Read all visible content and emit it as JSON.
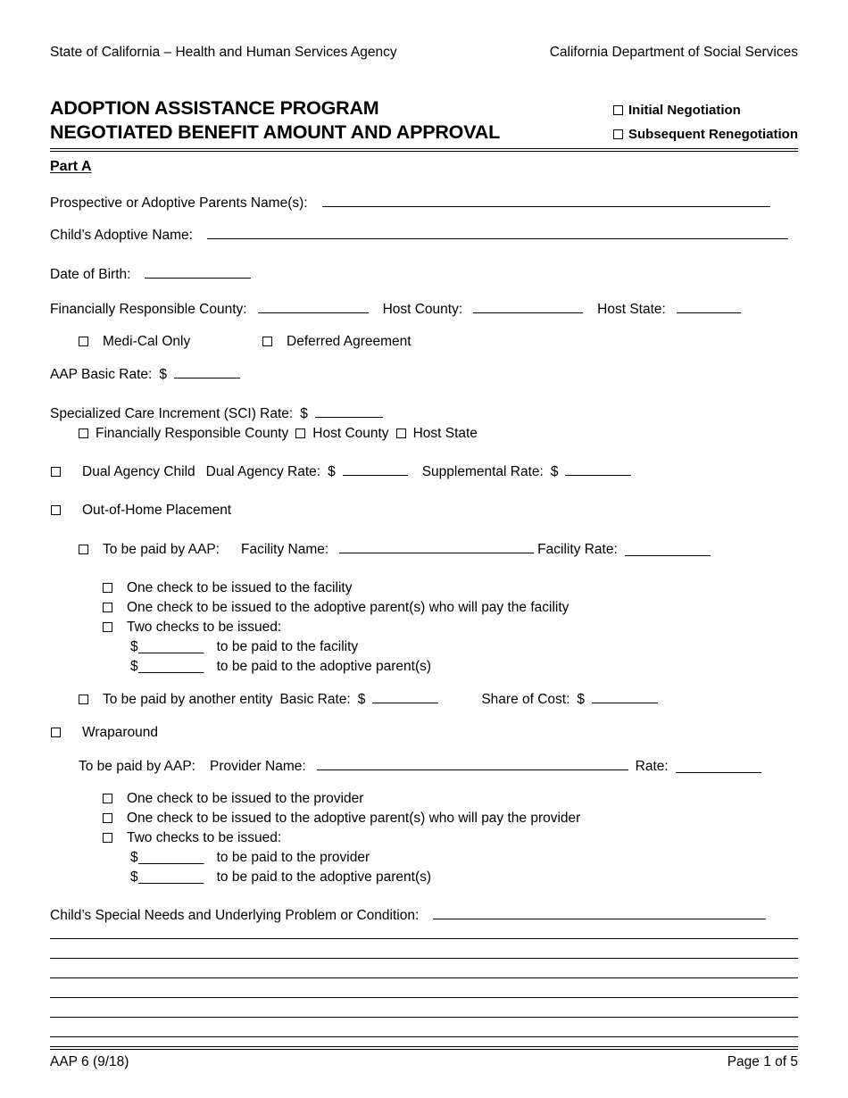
{
  "header": {
    "left": "State of California – Health and Human Services Agency",
    "right": "California Department of Social Services"
  },
  "title": {
    "line1": "ADOPTION ASSISTANCE PROGRAM",
    "line2": "NEGOTIATED BENEFIT AMOUNT AND APPROVAL",
    "option_initial": "Initial Negotiation",
    "option_subsequent": "Subsequent Renegotiation"
  },
  "part_label": "Part A",
  "fields": {
    "parents_name": "Prospective or Adoptive Parents Name(s):",
    "child_name": "Child’s Adoptive Name:",
    "dob": "Date of Birth:",
    "fin_county": "Financially Responsible County:",
    "host_county": "Host County:",
    "host_state": "Host State:",
    "medi_cal_only": "Medi-Cal Only",
    "deferred_agreement": "Deferred Agreement",
    "aap_basic_rate": "AAP Basic Rate:",
    "sci_rate": "Specialized Care Increment (SCI) Rate:",
    "sci_opt_fin_county": "Financially Responsible County",
    "sci_opt_host_county": "Host County",
    "sci_opt_host_state": "Host State",
    "dual_agency_child": "Dual Agency Child",
    "dual_agency_rate": "Dual Agency Rate:",
    "supplemental_rate": "Supplemental Rate:",
    "out_of_home": "Out-of-Home Placement",
    "paid_by_aap": "To be paid by AAP:",
    "facility_name": "Facility Name:",
    "facility_rate": "Facility Rate:",
    "fac_one_check_facility": "One check to be issued to the facility",
    "fac_one_check_parents": "One check to be issued to the adoptive parent(s) who will pay the facility",
    "fac_two_checks": "Two checks to be issued:",
    "fac_paid_facility": "to be paid to the facility",
    "fac_paid_parents": "to be paid to the adoptive parent(s)",
    "paid_other_entity": "To be paid by another entity",
    "basic_rate": "Basic Rate:",
    "share_of_cost": "Share of Cost:",
    "wraparound": "Wraparound",
    "provider_name": "Provider Name:",
    "rate": "Rate:",
    "prov_one_check_provider": "One check to be issued to the provider",
    "prov_one_check_parents": "One check to be issued to the adoptive parent(s) who will pay the provider",
    "prov_two_checks": "Two checks to be issued:",
    "prov_paid_provider": "to be paid to the provider",
    "prov_paid_parents": "to be paid to the adoptive parent(s)",
    "special_needs": "Child’s Special Needs and Underlying Problem or Condition:",
    "dollar_sign": "$"
  },
  "blanks": {
    "facility_rate_dashes": "____________",
    "wrap_rate_dashes": "____________",
    "money_short": "________",
    "money_mid": "_________"
  },
  "footer": {
    "form_id": "AAP 6 (9/18)",
    "page": "Page 1 of 5"
  }
}
